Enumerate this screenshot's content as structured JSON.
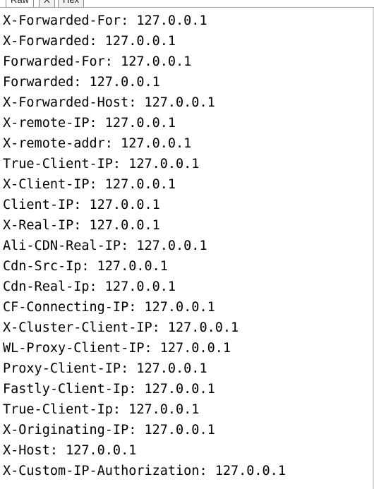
{
  "tabs": [
    {
      "label": "Raw",
      "active": true
    },
    {
      "label": "X",
      "active": false
    },
    {
      "label": "Hex",
      "active": false
    }
  ],
  "headers": [
    "X-Forwarded-For: 127.0.0.1",
    "X-Forwarded: 127.0.0.1",
    "Forwarded-For: 127.0.0.1",
    "Forwarded: 127.0.0.1",
    "X-Forwarded-Host: 127.0.0.1",
    "X-remote-IP: 127.0.0.1",
    "X-remote-addr: 127.0.0.1",
    "True-Client-IP: 127.0.0.1",
    "X-Client-IP: 127.0.0.1",
    "Client-IP: 127.0.0.1",
    "X-Real-IP: 127.0.0.1",
    "Ali-CDN-Real-IP: 127.0.0.1",
    "Cdn-Src-Ip: 127.0.0.1",
    "Cdn-Real-Ip: 127.0.0.1",
    "CF-Connecting-IP: 127.0.0.1",
    "X-Cluster-Client-IP: 127.0.0.1",
    "WL-Proxy-Client-IP: 127.0.0.1",
    "Proxy-Client-IP: 127.0.0.1",
    "Fastly-Client-Ip: 127.0.0.1",
    "True-Client-Ip: 127.0.0.1",
    "X-Originating-IP: 127.0.0.1",
    "X-Host: 127.0.0.1",
    "X-Custom-IP-Authorization: 127.0.0.1"
  ]
}
